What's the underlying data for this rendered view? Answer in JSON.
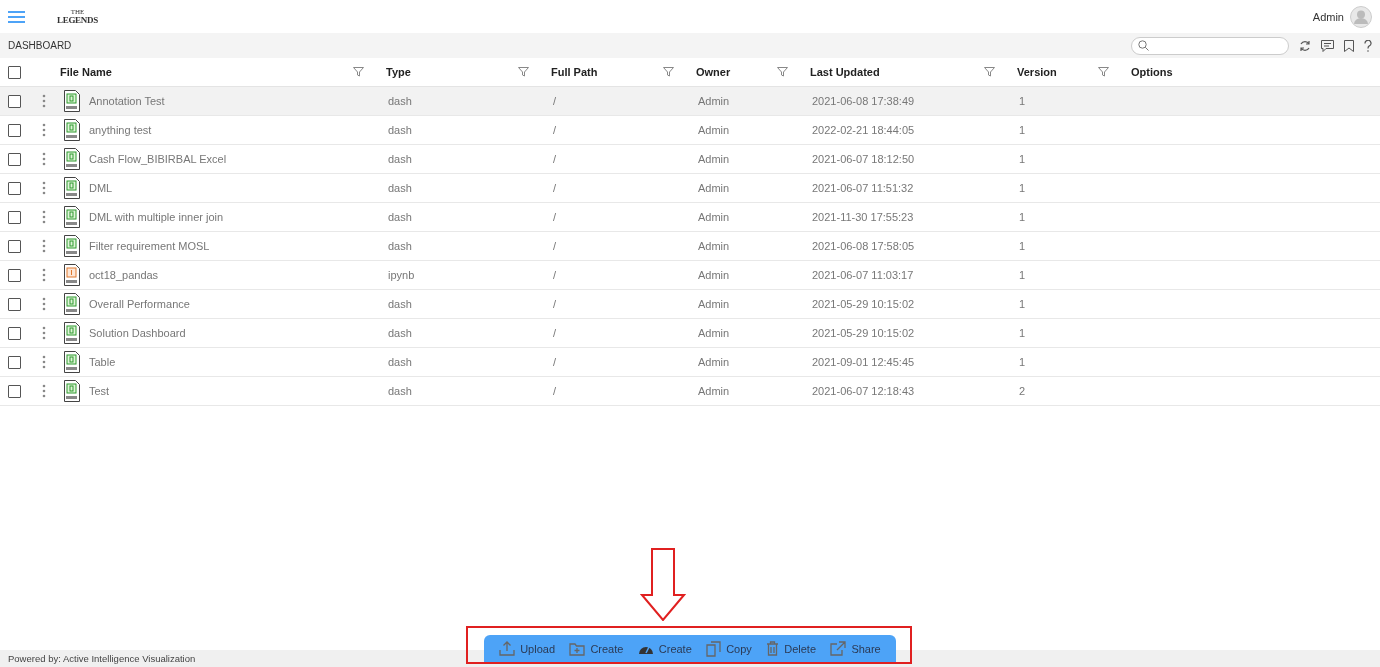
{
  "header": {
    "logo": {
      "top": "THE",
      "main": "LEGENDS"
    },
    "user": "Admin"
  },
  "toolbar": {
    "title": "DASHBOARD"
  },
  "table": {
    "select_all": {
      "checked": false
    },
    "columns": [
      {
        "label": "File Name",
        "kind": "filterable"
      },
      {
        "label": "Type",
        "kind": "filterable"
      },
      {
        "label": "Full Path",
        "kind": "filterable"
      },
      {
        "label": "Owner",
        "kind": "filterable"
      },
      {
        "label": "Last Updated",
        "kind": "filterable"
      },
      {
        "label": "Version",
        "kind": "filterable"
      },
      {
        "label": "Options",
        "kind": "plain"
      }
    ],
    "rows": [
      {
        "kind": "dash",
        "name": "Annotation Test",
        "type": "dash",
        "path": "/",
        "owner": "Admin",
        "updated": "2021-06-08 17:38:49",
        "version": "1",
        "checked": false,
        "highlighted": true
      },
      {
        "kind": "dash",
        "name": "anything test",
        "type": "dash",
        "path": "/",
        "owner": "Admin",
        "updated": "2022-02-21 18:44:05",
        "version": "1",
        "checked": false,
        "highlighted": false
      },
      {
        "kind": "dash",
        "name": "Cash Flow_BIBIRBAL Excel",
        "type": "dash",
        "path": "/",
        "owner": "Admin",
        "updated": "2021-06-07 18:12:50",
        "version": "1",
        "checked": false,
        "highlighted": false
      },
      {
        "kind": "dash",
        "name": "DML",
        "type": "dash",
        "path": "/",
        "owner": "Admin",
        "updated": "2021-06-07 11:51:32",
        "version": "1",
        "checked": false,
        "highlighted": false
      },
      {
        "kind": "dash",
        "name": "DML with multiple inner join",
        "type": "dash",
        "path": "/",
        "owner": "Admin",
        "updated": "2021-11-30 17:55:23",
        "version": "1",
        "checked": false,
        "highlighted": false
      },
      {
        "kind": "dash",
        "name": "Filter requirement MOSL",
        "type": "dash",
        "path": "/",
        "owner": "Admin",
        "updated": "2021-06-08 17:58:05",
        "version": "1",
        "checked": false,
        "highlighted": false
      },
      {
        "kind": "notebook",
        "name": "oct18_pandas",
        "type": "ipynb",
        "path": "/",
        "owner": "Admin",
        "updated": "2021-06-07 11:03:17",
        "version": "1",
        "checked": false,
        "highlighted": false
      },
      {
        "kind": "dash",
        "name": "Overall Performance",
        "type": "dash",
        "path": "/",
        "owner": "Admin",
        "updated": "2021-05-29 10:15:02",
        "version": "1",
        "checked": false,
        "highlighted": false
      },
      {
        "kind": "dash",
        "name": "Solution Dashboard",
        "type": "dash",
        "path": "/",
        "owner": "Admin",
        "updated": "2021-05-29 10:15:02",
        "version": "1",
        "checked": false,
        "highlighted": false
      },
      {
        "kind": "dash",
        "name": "Table",
        "type": "dash",
        "path": "/",
        "owner": "Admin",
        "updated": "2021-09-01 12:45:45",
        "version": "1",
        "checked": false,
        "highlighted": false
      },
      {
        "kind": "dash",
        "name": "Test",
        "type": "dash",
        "path": "/",
        "owner": "Admin",
        "updated": "2021-06-07 12:18:43",
        "version": "2",
        "checked": false,
        "highlighted": false
      }
    ]
  },
  "action_bar": {
    "buttons": [
      {
        "kind": "upload",
        "label": "Upload"
      },
      {
        "kind": "folder",
        "label": "Create"
      },
      {
        "kind": "gauge",
        "label": "Create"
      },
      {
        "kind": "copy",
        "label": "Copy"
      },
      {
        "kind": "delete",
        "label": "Delete"
      },
      {
        "kind": "share",
        "label": "Share"
      }
    ]
  },
  "footer": {
    "text": "Powered by: Active Intelligence Visualization"
  }
}
